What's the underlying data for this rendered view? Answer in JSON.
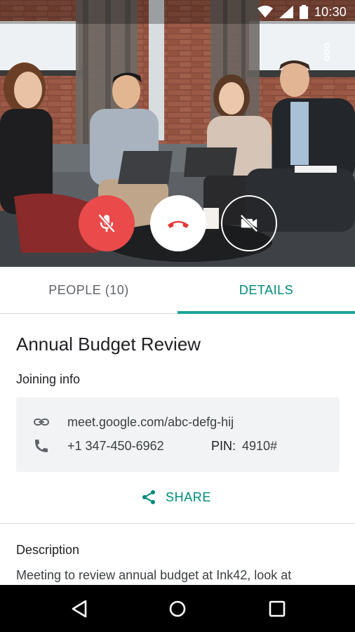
{
  "status_bar": {
    "time": "10:30",
    "icons": [
      "wifi-icon",
      "signal-icon",
      "battery-icon"
    ]
  },
  "video": {
    "controls": [
      {
        "name": "mute-mic-button",
        "icon": "mic-off-icon",
        "color": "#ea4a4a"
      },
      {
        "name": "hang-up-button",
        "icon": "phone-hangup-icon",
        "color": "#ffffff"
      },
      {
        "name": "camera-off-button",
        "icon": "videocam-off-icon",
        "color": "transparent"
      }
    ],
    "overflow_icon": "more-vert-icon"
  },
  "tabs": [
    {
      "label": "PEOPLE (10)",
      "active": false
    },
    {
      "label": "DETAILS",
      "active": true
    }
  ],
  "details": {
    "title": "Annual Budget Review",
    "joining_label": "Joining info",
    "link": "meet.google.com/abc-defg-hij",
    "phone": "+1 347-450-6962",
    "pin_label": "PIN:",
    "pin": "4910#",
    "share_label": "SHARE",
    "description_label": "Description",
    "description_text": "Meeting to review annual budget at Ink42, look at"
  },
  "colors": {
    "accent": "#00897b",
    "mic_off_red": "#ea4a4a",
    "hangup_red": "#e53935",
    "info_box_bg": "#f1f3f4"
  },
  "navbar": {
    "icons": [
      "back-icon",
      "home-icon",
      "recents-icon"
    ]
  }
}
